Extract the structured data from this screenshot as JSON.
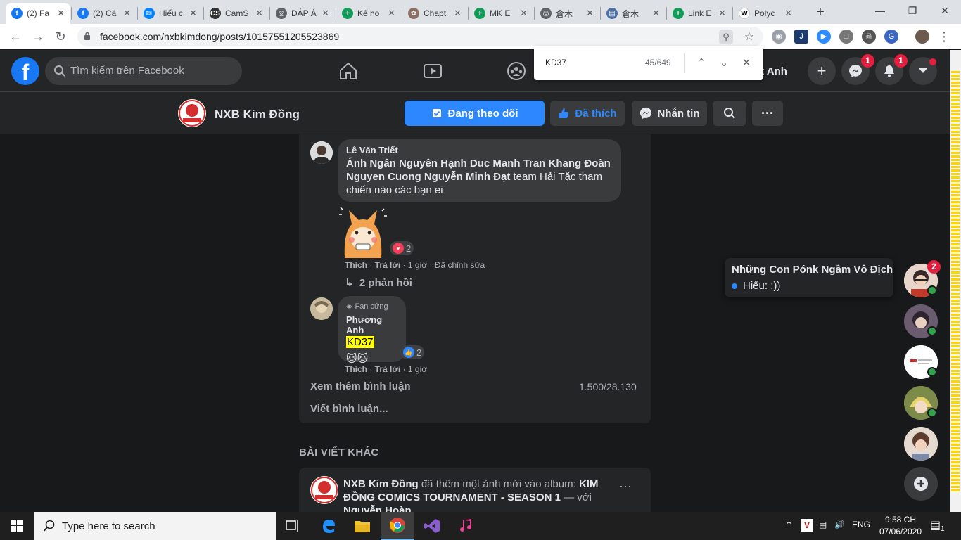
{
  "browser": {
    "tabs": [
      {
        "title": "(2) Fa",
        "favicon": "facebook-icon",
        "color": "#1877f2",
        "active": true
      },
      {
        "title": "(2) Cá",
        "favicon": "facebook-icon",
        "color": "#1877f2",
        "active": false
      },
      {
        "title": "Hiếu c",
        "favicon": "messenger-icon",
        "color": "#0084ff",
        "active": false
      },
      {
        "title": "CamS",
        "favicon": "cs-icon",
        "color": "#333333",
        "active": false
      },
      {
        "title": "ĐÁP Á",
        "favicon": "globe-icon",
        "color": "#5f6368",
        "active": false
      },
      {
        "title": "Kế ho",
        "favicon": "sheets-icon",
        "color": "#0f9d58",
        "active": false
      },
      {
        "title": "Chapt",
        "favicon": "manga-icon",
        "color": "#8d6e63",
        "active": false
      },
      {
        "title": "MK E",
        "favicon": "sheets-icon",
        "color": "#0f9d58",
        "active": false
      },
      {
        "title": "倉木",
        "favicon": "globe-icon",
        "color": "#5f6368",
        "active": false
      },
      {
        "title": "倉木",
        "favicon": "doc-icon",
        "color": "#4a6fa5",
        "active": false
      },
      {
        "title": "Link E",
        "favicon": "sheets-icon",
        "color": "#0f9d58",
        "active": false
      },
      {
        "title": "Polyc",
        "favicon": "wikipedia-icon",
        "color": "#ffffff",
        "active": false
      }
    ],
    "url": "facebook.com/nxbkimdong/posts/10157551205523869"
  },
  "findbar": {
    "query": "KD37",
    "count": "45/649"
  },
  "fbnav": {
    "search_placeholder": "Tìm kiếm trên Facebook",
    "username": "ut Anh",
    "messenger_badge": "1",
    "notifications_badge": "1"
  },
  "page": {
    "name": "NXB Kim Đồng",
    "follow_label": "Đang theo dõi",
    "liked_label": "Đã thích",
    "message_label": "Nhắn tin"
  },
  "comments": [
    {
      "author": "Lê Văn Triết",
      "mentions": "Ánh Ngân Nguyên Hạnh Duc Manh Tran Khang Đoàn Nguyen Cuong Nguyễn Minh Đạt",
      "text": " team Hải Tặc tham chiến nào các bạn ei",
      "reaction_count": "2",
      "like": "Thích",
      "reply": "Trả lời",
      "time": "1 giờ",
      "edited": "Đã chỉnh sửa",
      "replies": "2 phản hồi"
    },
    {
      "badge": "Fan cứng",
      "author": "Phương Anh",
      "text": "KD37",
      "emoji": "🐱🐱",
      "reaction_count": "2",
      "like": "Thích",
      "reply": "Trả lời",
      "time": "1 giờ"
    }
  ],
  "comment_footer": {
    "more": "Xem thêm bình luận",
    "count": "1.500/28.130",
    "write": "Viết bình luận..."
  },
  "other_posts": {
    "header": "BÀI VIẾT KHÁC",
    "author": "NXB Kim Đồng",
    "action": " đã thêm một ảnh mới vào album: ",
    "album": "KIM ĐỒNG COMICS TOURNAMENT - SEASON 1",
    "with": " — với ",
    "tagged": "Nguyễn Hoàn"
  },
  "chat": {
    "popup_title": "Những Con Pónk Ngầm Vô Địch",
    "popup_sender": "Hiếu",
    "popup_message": ":))",
    "badge": "2"
  },
  "taskbar": {
    "search_placeholder": "Type here to search",
    "lang": "ENG",
    "time": "9:58 CH",
    "date": "07/06/2020",
    "notif_count": "1"
  }
}
